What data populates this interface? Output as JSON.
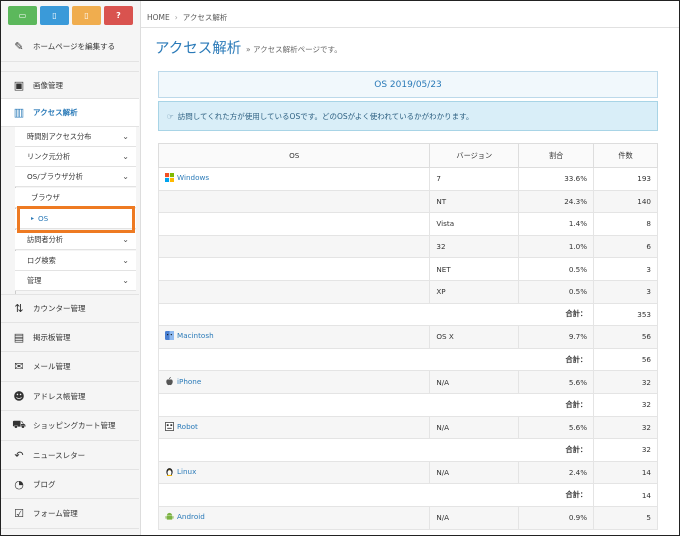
{
  "top_buttons": [
    {
      "icon": "monitor-icon",
      "color": "#5cb85c",
      "glyph": "▭"
    },
    {
      "icon": "tablet-icon",
      "color": "#3a9ad9",
      "glyph": "▯"
    },
    {
      "icon": "mobile-icon",
      "color": "#f0ad4e",
      "glyph": "▯"
    },
    {
      "icon": "help-icon",
      "color": "#d9534f",
      "glyph": "?"
    }
  ],
  "sidebar": {
    "edit_home": "ホームページを編集する",
    "images": "画像管理",
    "analytics": "アクセス解析",
    "sub": {
      "time": "時間別アクセス分布",
      "link": "リンク元分析",
      "osbrowser": "OS/ブラウザ分析",
      "browser": "ブラウザ",
      "os": "OS",
      "visitor": "訪問者分析",
      "log": "ログ検索",
      "manage": "管理"
    },
    "counter": "カウンター管理",
    "bbs": "掲示板管理",
    "mail": "メール管理",
    "address": "アドレス帳管理",
    "cart": "ショッピングカート管理",
    "news": "ニュースレター",
    "blog": "ブログ",
    "form": "フォーム管理"
  },
  "breadcrumb": {
    "home": "HOME",
    "sep": "›",
    "current": "アクセス解析"
  },
  "page": {
    "title": "アクセス解析",
    "sub_prefix": "»",
    "subtitle": "アクセス解析ページです。"
  },
  "box_title": "OS 2019/05/23",
  "info_text": "訪問してくれた方が使用しているOSです。どのOSがよく使われているかがわかります。",
  "table": {
    "headers": {
      "os": "OS",
      "version": "バージョン",
      "ratio": "割合",
      "count": "件数"
    },
    "total_label": "合計：",
    "rows": {
      "windows": {
        "name": "Windows",
        "versions": [
          {
            "v": "7",
            "r": "33.6%",
            "c": "193"
          },
          {
            "v": "NT",
            "r": "24.3%",
            "c": "140"
          },
          {
            "v": "Vista",
            "r": "1.4%",
            "c": "8"
          },
          {
            "v": "32",
            "r": "1.0%",
            "c": "6"
          },
          {
            "v": "NET",
            "r": "0.5%",
            "c": "3"
          },
          {
            "v": "XP",
            "r": "0.5%",
            "c": "3"
          }
        ],
        "total": "353"
      },
      "mac": {
        "name": "Macintosh",
        "v": "OS X",
        "r": "9.7%",
        "c": "56",
        "total": "56"
      },
      "iphone": {
        "name": "iPhone",
        "v": "N/A",
        "r": "5.6%",
        "c": "32",
        "total": "32"
      },
      "robot": {
        "name": "Robot",
        "v": "N/A",
        "r": "5.6%",
        "c": "32",
        "total": "32"
      },
      "linux": {
        "name": "Linux",
        "v": "N/A",
        "r": "2.4%",
        "c": "14",
        "total": "14"
      },
      "android": {
        "name": "Android",
        "v": "N/A",
        "r": "0.9%",
        "c": "5"
      }
    }
  },
  "colors": {
    "accent": "#2a7ab8",
    "highlight": "#ee7a22"
  }
}
